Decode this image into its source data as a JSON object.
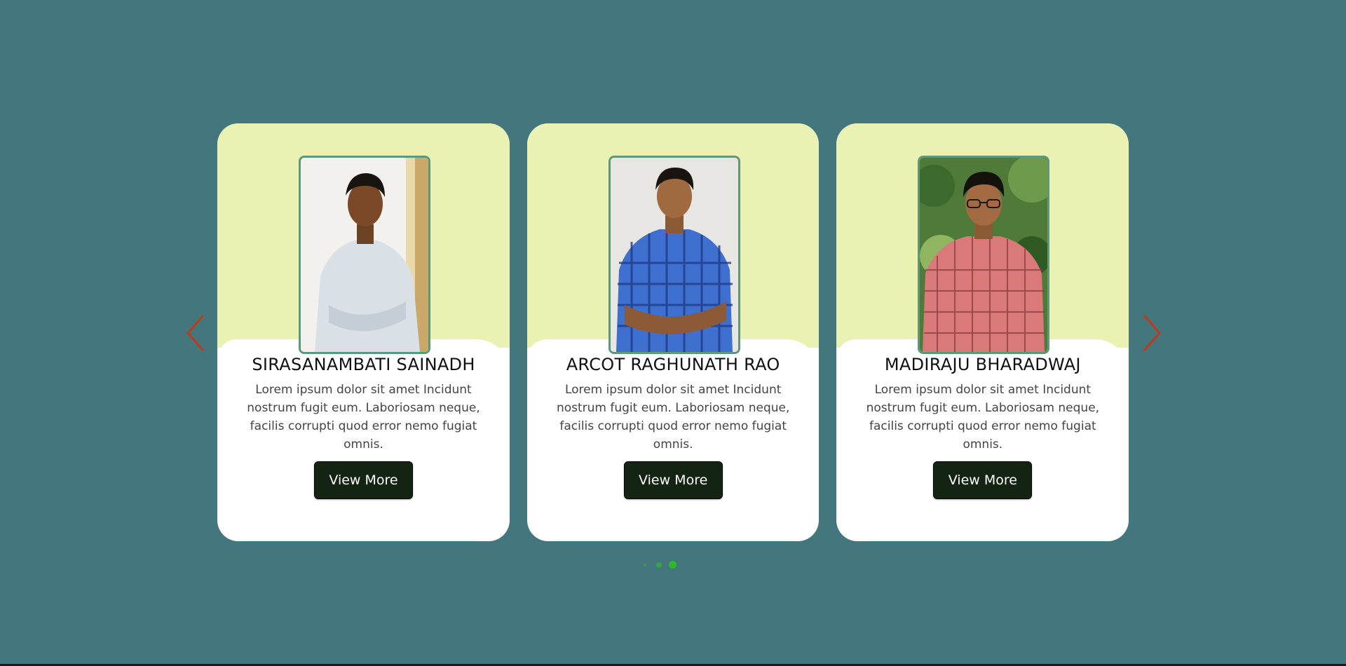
{
  "colors": {
    "background": "#44777d",
    "card_top": "#eaf2b3",
    "button": "#142412",
    "arrow": "#c0391b",
    "dot_active": "#2db82d"
  },
  "carousel": {
    "prev_icon": "chevron-left-icon",
    "next_icon": "chevron-right-icon",
    "dots_count": 3,
    "active_dot": 3,
    "cards": [
      {
        "name": "SIRASANAMBATI SAINADH",
        "description": "Lorem ipsum dolor sit amet Incidunt nostrum fugit eum. Laboriosam neque, facilis corrupti quod error nemo fugiat omnis.",
        "button_label": "View More",
        "photo": "person-photo"
      },
      {
        "name": "ARCOT RAGHUNATH RAO",
        "description": "Lorem ipsum dolor sit amet Incidunt nostrum fugit eum. Laboriosam neque, facilis corrupti quod error nemo fugiat omnis.",
        "button_label": "View More",
        "photo": "person-photo"
      },
      {
        "name": "MADIRAJU BHARADWAJ",
        "description": "Lorem ipsum dolor sit amet Incidunt nostrum fugit eum. Laboriosam neque, facilis corrupti quod error nemo fugiat omnis.",
        "button_label": "View More",
        "photo": "person-photo"
      }
    ]
  }
}
